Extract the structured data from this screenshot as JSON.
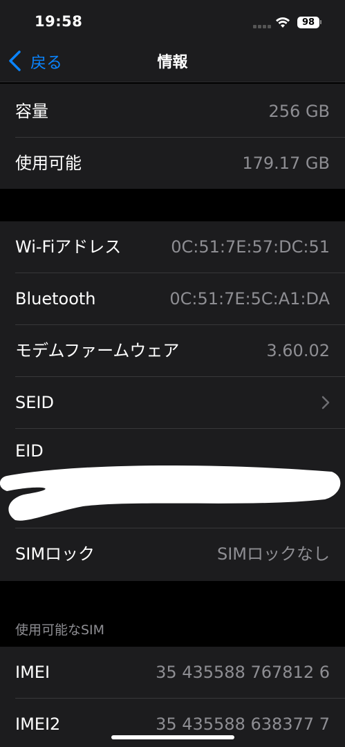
{
  "status_bar": {
    "time": "19:58",
    "battery": "98"
  },
  "nav": {
    "back_label": "戻る",
    "title": "情報"
  },
  "storage": [
    {
      "label": "容量",
      "value": "256 GB"
    },
    {
      "label": "使用可能",
      "value": "179.17 GB"
    }
  ],
  "network": {
    "wifi": {
      "label": "Wi-Fiアドレス",
      "value": "0C:51:7E:57:DC:51"
    },
    "bluetooth": {
      "label": "Bluetooth",
      "value": "0C:51:7E:5C:A1:DA"
    },
    "modem": {
      "label": "モデムファームウェア",
      "value": "3.60.02"
    },
    "seid": {
      "label": "SEID"
    },
    "eid": {
      "label": "EID"
    },
    "simlock": {
      "label": "SIMロック",
      "value": "SIMロックなし"
    }
  },
  "sim_section": {
    "header": "使用可能なSIM",
    "imei": {
      "label": "IMEI",
      "value": "35 435588 767812 6"
    },
    "imei2": {
      "label": "IMEI2",
      "value": "35 435588 638377 7"
    }
  },
  "colors": {
    "accent": "#0a84ff",
    "background": "#000000",
    "group": "#1c1c1e",
    "secondary_text": "#8e8e93"
  },
  "icons": [
    "wifi-icon",
    "battery-icon",
    "back-chevron-icon",
    "chevron-right-icon"
  ]
}
